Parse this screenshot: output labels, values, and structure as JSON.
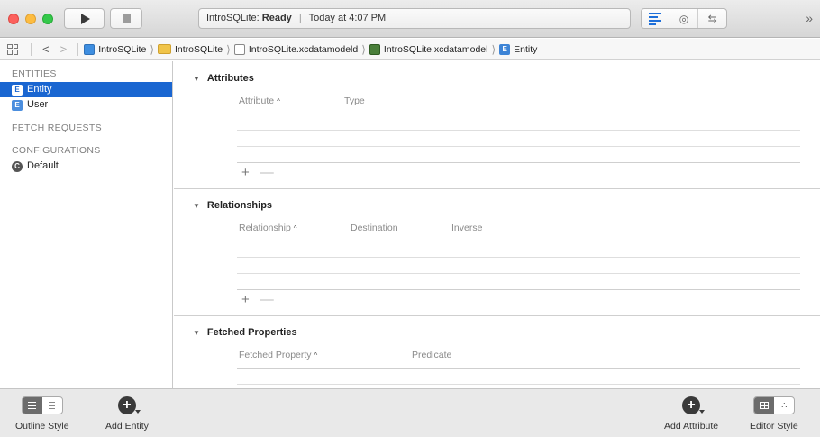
{
  "toolbar": {
    "activity_project": "IntroSQLite:",
    "activity_status": "Ready",
    "activity_time": "Today at 4:07 PM",
    "overflow": "»",
    "icons": [
      "close-light",
      "minimize-light",
      "zoom-light",
      "run-icon",
      "stop-icon",
      "standard-editor-icon",
      "assistant-editor-icon",
      "version-editor-icon"
    ]
  },
  "jumpbar": {
    "back": "<",
    "forward": ">",
    "crumbs": [
      {
        "label": "IntroSQLite",
        "icon": "project-icon"
      },
      {
        "label": "IntroSQLite",
        "icon": "folder-icon"
      },
      {
        "label": "IntroSQLite.xcdatamodeld",
        "icon": "datamodel-bundle-icon"
      },
      {
        "label": "IntroSQLite.xcdatamodel",
        "icon": "datamodel-icon"
      },
      {
        "label": "Entity",
        "icon": "entity-icon"
      }
    ],
    "crumb_separator": "⟩"
  },
  "sidebar": {
    "entities_header": "ENTITIES",
    "entities": [
      {
        "label": "Entity",
        "badge": "E",
        "selected": true
      },
      {
        "label": "User",
        "badge": "E",
        "selected": false
      }
    ],
    "fetch_requests_header": "FETCH REQUESTS",
    "configurations_header": "CONFIGURATIONS",
    "configurations": [
      {
        "label": "Default",
        "badge": "C"
      }
    ],
    "selection_color": "#1a66d1"
  },
  "main": {
    "attributes": {
      "title": "Attributes",
      "columns": [
        "Attribute",
        "Type"
      ]
    },
    "relationships": {
      "title": "Relationships",
      "columns": [
        "Relationship",
        "Destination",
        "Inverse"
      ]
    },
    "fetched_properties": {
      "title": "Fetched Properties",
      "columns": [
        "Fetched Property",
        "Predicate"
      ]
    },
    "plus": "+",
    "minus": "—",
    "disclosure": "▼",
    "sort_indicator": "^"
  },
  "bottombar": {
    "outline_style_label": "Outline Style",
    "add_entity_label": "Add Entity",
    "add_attribute_label": "Add Attribute",
    "editor_style_label": "Editor Style",
    "add_symbol": "+"
  }
}
